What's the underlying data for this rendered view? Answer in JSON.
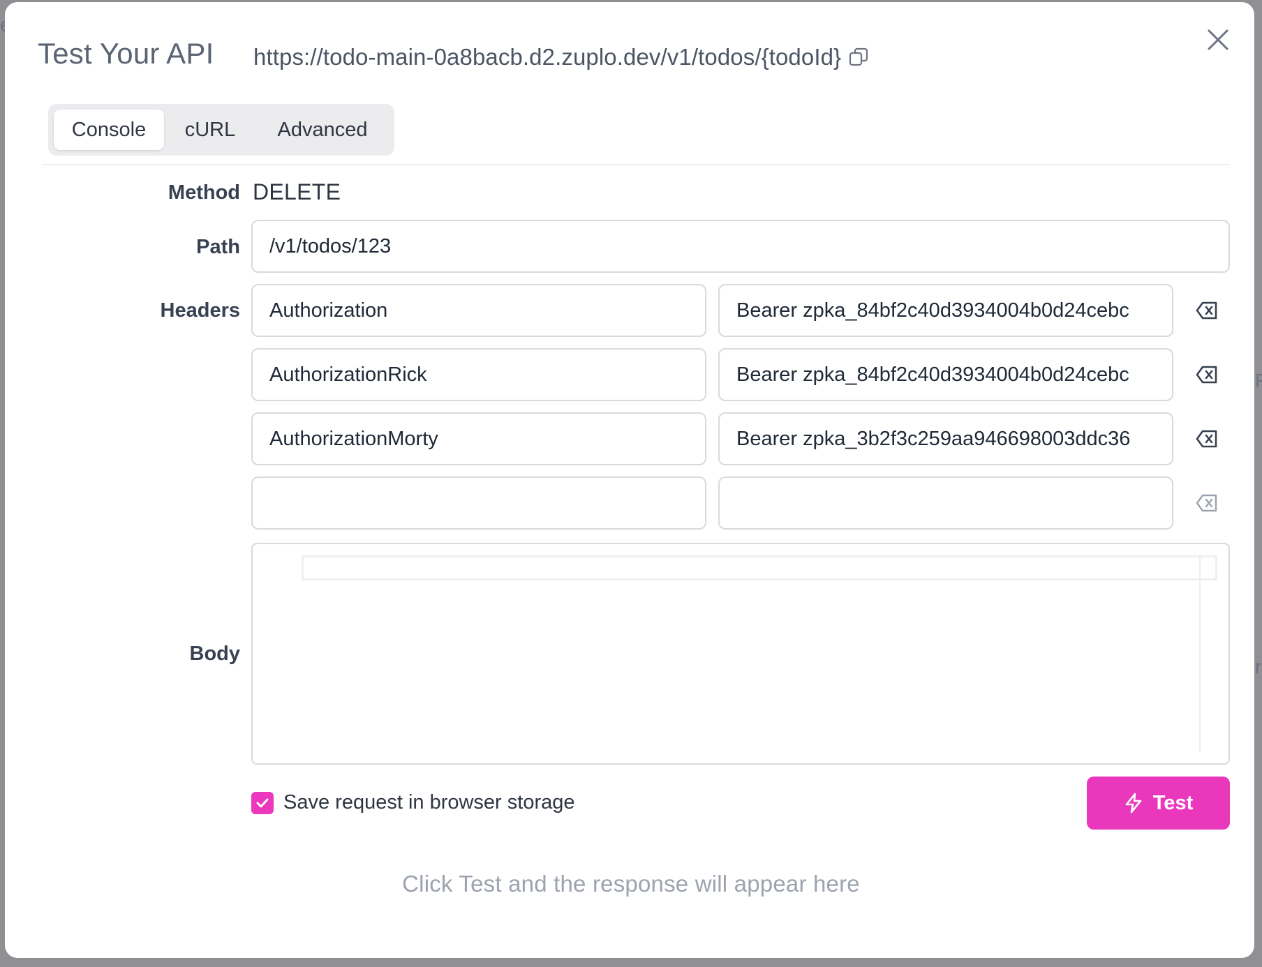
{
  "modal": {
    "title": "Test Your API",
    "url": "https://todo-main-0a8bacb.d2.zuplo.dev/v1/todos/{todoId}"
  },
  "tabs": [
    {
      "label": "Console",
      "active": true
    },
    {
      "label": "cURL",
      "active": false
    },
    {
      "label": "Advanced",
      "active": false
    }
  ],
  "form": {
    "method_label": "Method",
    "method_value": "DELETE",
    "path_label": "Path",
    "path_value": "/v1/todos/123",
    "headers_label": "Headers",
    "headers": [
      {
        "name": "Authorization",
        "value": "Bearer zpka_84bf2c40d3934004b0d24cebc"
      },
      {
        "name": "AuthorizationRick",
        "value": "Bearer zpka_84bf2c40d3934004b0d24cebc"
      },
      {
        "name": "AuthorizationMorty",
        "value": "Bearer zpka_3b2f3c259aa946698003ddc36"
      },
      {
        "name": "",
        "value": ""
      }
    ],
    "body_label": "Body"
  },
  "save": {
    "label": "Save request in browser storage",
    "checked": true
  },
  "test_button": {
    "label": "Test"
  },
  "response_hint": "Click Test and the response will appear here",
  "colors": {
    "accent": "#ea38bd",
    "text": "#2f3642",
    "muted": "#9ca3af"
  },
  "icons": {
    "copy": "copy-icon",
    "close": "close-icon",
    "delete": "backspace-delete-icon",
    "check": "check-icon",
    "bolt": "lightning-bolt-icon"
  }
}
